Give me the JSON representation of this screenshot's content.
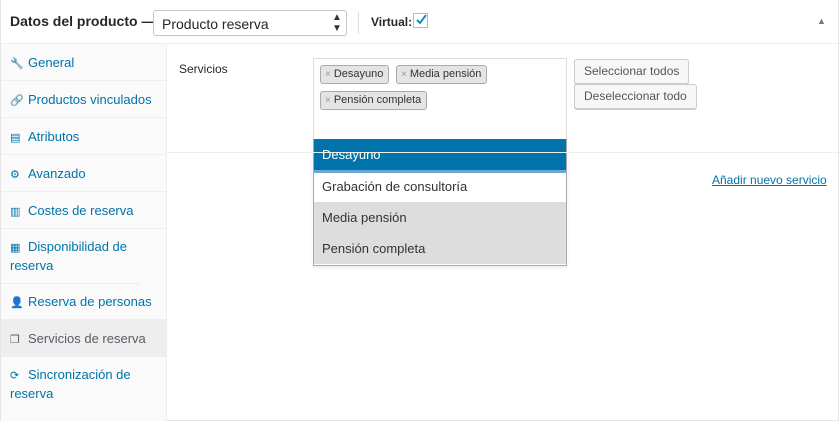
{
  "header": {
    "title": "Datos del producto —",
    "product_type": "Producto reserva",
    "virtual_label": "Virtual:",
    "virtual_checked": true,
    "collapse_icon": "triangle-up-icon"
  },
  "sidebar": {
    "items": [
      {
        "label": "General",
        "icon": "wrench-icon",
        "glyph": "🔧"
      },
      {
        "label": "Productos vinculados",
        "icon": "link-icon",
        "glyph": "🔗"
      },
      {
        "label": "Atributos",
        "icon": "list-icon",
        "glyph": "▤"
      },
      {
        "label": "Avanzado",
        "icon": "gear-icon",
        "glyph": "⚙"
      },
      {
        "label": "Costes de reserva",
        "icon": "chart-icon",
        "glyph": "▥"
      },
      {
        "label": "Disponibilidad de reserva",
        "icon": "calendar-icon",
        "glyph": "▦"
      },
      {
        "label": "Reserva de personas",
        "icon": "person-icon",
        "glyph": "👤"
      },
      {
        "label": "Servicios de reserva",
        "icon": "window-icon",
        "glyph": "❐",
        "active": true
      },
      {
        "label": "Sincronización de reserva",
        "icon": "sync-icon",
        "glyph": "⟳"
      }
    ]
  },
  "services": {
    "label": "Servicios",
    "selected": [
      "Desayuno",
      "Media pensión",
      "Pensión completa"
    ],
    "options": [
      "Desayuno",
      "Grabación de consultoría",
      "Media pensión",
      "Pensión completa"
    ],
    "select_all": "Seleccionar todos",
    "deselect_all": "Deseleccionar todo",
    "add_link": "Añadir nuevo servicio"
  },
  "colors": {
    "accent": "#0073aa",
    "highlight": "#0073aa"
  }
}
